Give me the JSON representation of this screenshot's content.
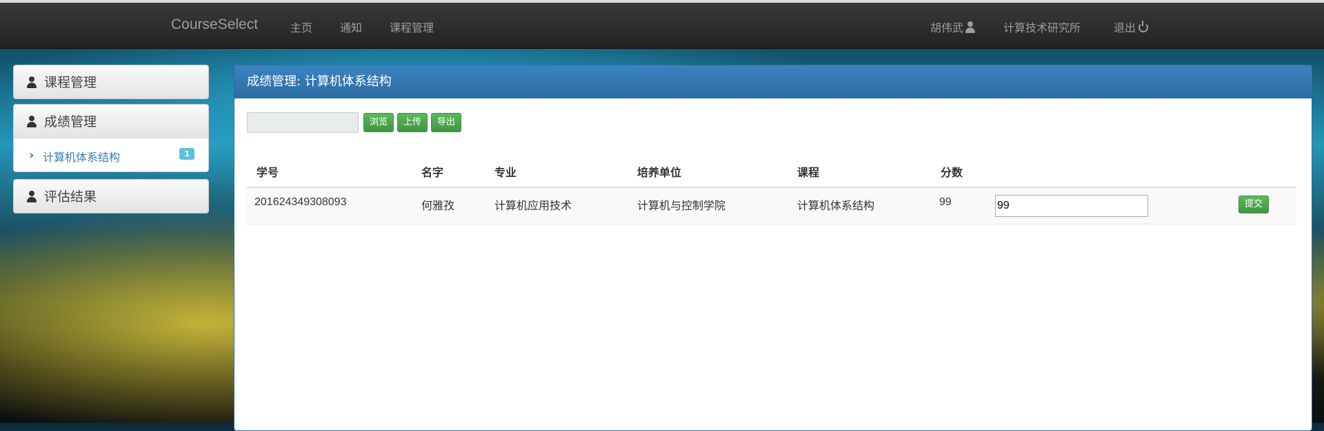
{
  "navbar": {
    "brand": "CourseSelect",
    "links": [
      "主页",
      "通知",
      "课程管理"
    ],
    "user_name": "胡伟武",
    "department": "计算技术研究所",
    "logout": "退出"
  },
  "sidebar": {
    "panels": [
      {
        "title": "课程管理"
      },
      {
        "title": "成绩管理",
        "items": [
          {
            "label": "计算机体系结构",
            "badge": "1"
          }
        ]
      },
      {
        "title": "评估结果"
      }
    ]
  },
  "main": {
    "title": "成绩管理: 计算机体系结构",
    "buttons": {
      "browse": "浏览",
      "upload": "上传",
      "export": "导出"
    },
    "table": {
      "headers": [
        "学号",
        "名字",
        "专业",
        "培养单位",
        "课程",
        "分数"
      ],
      "rows": [
        {
          "student_id": "201624349308093",
          "name": "何雅孜",
          "major": "计算机应用技术",
          "unit": "计算机与控制学院",
          "course": "计算机体系结构",
          "score": "99",
          "input_value": "99",
          "submit": "提交"
        }
      ]
    }
  }
}
